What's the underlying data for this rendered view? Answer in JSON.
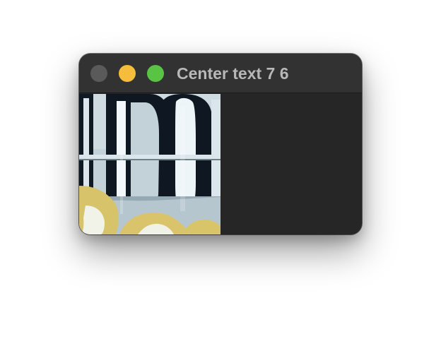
{
  "window": {
    "title": "Center text 7 6",
    "controls": {
      "close_color": "#5a5a5a",
      "minimize_color": "#f6bd3c",
      "zoom_color": "#59c344"
    },
    "title_color": "#b8b8b8",
    "background": "#262626"
  },
  "content": {
    "image": {
      "description_name": "cropped-signage-photo",
      "colors": {
        "panel": "#c3d2d9",
        "ink": "#0f1722",
        "rail": "#dbe6ec",
        "gold": "#d9c46b"
      }
    }
  }
}
